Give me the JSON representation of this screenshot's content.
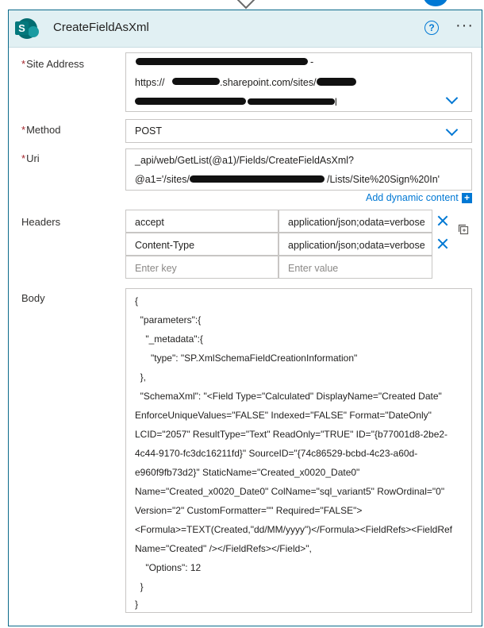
{
  "card": {
    "title": "CreateFieldAsXml",
    "help_glyph": "?",
    "more_glyph": "···",
    "logo_letter": "S",
    "colors": {
      "accent": "#0078d4",
      "header_bg": "#e1f0f3",
      "required": "#a4262c",
      "border": "#0b6a8a"
    }
  },
  "site_address": {
    "label": "Site Address",
    "required_mark": "*",
    "line1_suffix": " -",
    "line2_a": "https://",
    "line2_b": ".sharepoint.com/sites/",
    "line3_suffix": "l"
  },
  "method": {
    "label": "Method",
    "required_mark": "*",
    "value": "POST"
  },
  "uri": {
    "label": "Uri",
    "required_mark": "*",
    "line1": "_api/web/GetList(@a1)/Fields/CreateFieldAsXml?",
    "line2_a": "@a1='/sites/",
    "line2_b": "/Lists/Site%20Sign%20In'"
  },
  "dynamic_content": {
    "label": "Add dynamic content",
    "plus_glyph": "+"
  },
  "headers": {
    "label": "Headers",
    "rows": [
      {
        "key": "accept",
        "value": "application/json;odata=verbose"
      },
      {
        "key": "Content-Type",
        "value": "application/json;odata=verbose"
      }
    ],
    "key_placeholder": "Enter key",
    "value_placeholder": "Enter value"
  },
  "body": {
    "label": "Body",
    "lines": [
      "{",
      "  \"parameters\":{",
      "    \"_metadata\":{",
      "      \"type\": \"SP.XmlSchemaFieldCreationInformation\"",
      "  },",
      "  \"SchemaXml\": \"<Field Type=\"Calculated\" DisplayName=\"Created Date\"",
      "EnforceUniqueValues=\"FALSE\" Indexed=\"FALSE\" Format=\"DateOnly\"",
      "LCID=\"2057\" ResultType=\"Text\" ReadOnly=\"TRUE\" ID=\"{b77001d8-2be2-",
      "4c44-9170-fc3dc16211fd}\" SourceID=\"{74c86529-bcbd-4c23-a60d-",
      "e960f9fb73d2}\" StaticName=\"Created_x0020_Date0\"",
      "Name=\"Created_x0020_Date0\" ColName=\"sql_variant5\" RowOrdinal=\"0\"",
      "Version=\"2\" CustomFormatter=\"\" Required=\"FALSE\">",
      "<Formula>=TEXT(Created,\"dd/MM/yyyy\")</Formula><FieldRefs><FieldRef",
      "Name=\"Created\" /></FieldRefs></Field>\",",
      "    \"Options\": 12",
      "  }",
      "}"
    ]
  }
}
